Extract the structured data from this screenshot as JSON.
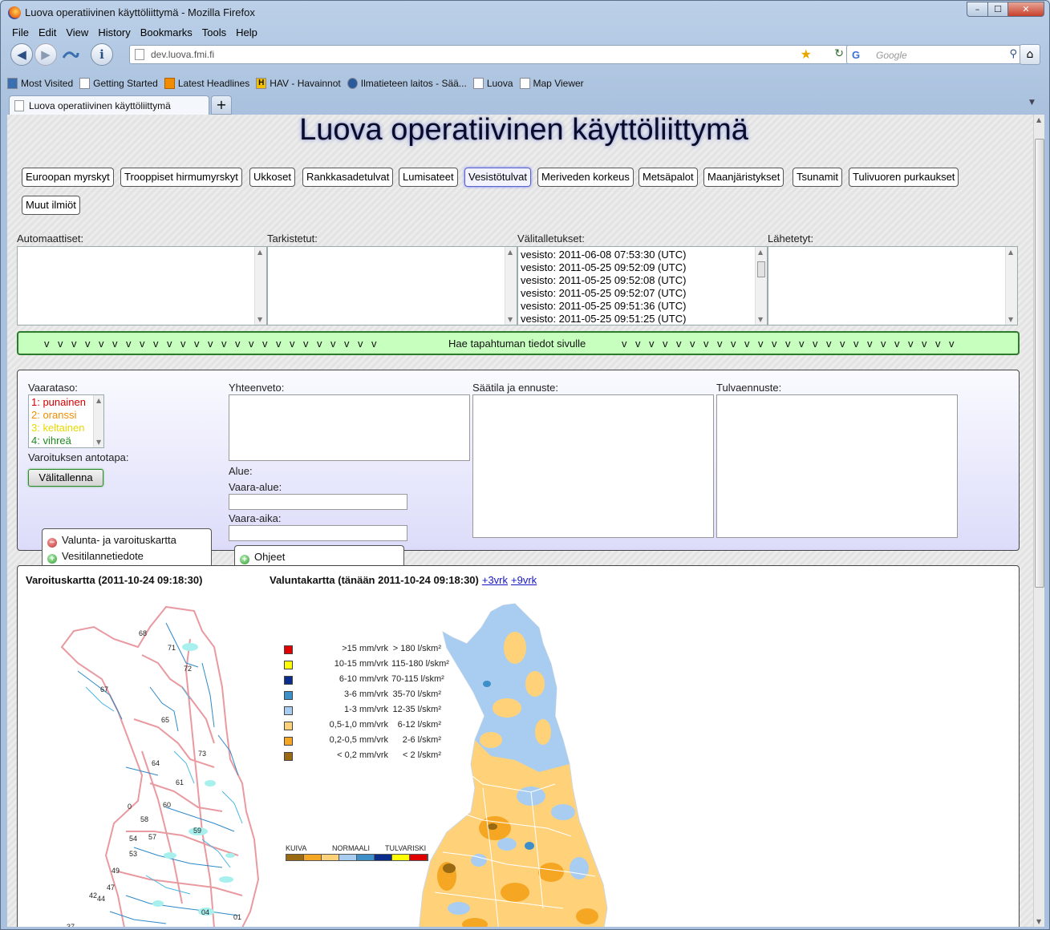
{
  "window": {
    "title": "Luova operatiivinen käyttöliittymä - Mozilla Firefox",
    "controls": {
      "min": "–",
      "max": "☐",
      "close": "✕"
    }
  },
  "menus": [
    "File",
    "Edit",
    "View",
    "History",
    "Bookmarks",
    "Tools",
    "Help"
  ],
  "nav": {
    "back": "◀",
    "forward": "▶",
    "url": "dev.luova.fmi.fi",
    "search_placeholder": "Google",
    "home": "⌂"
  },
  "bookmarks": [
    "Most Visited",
    "Getting Started",
    "Latest Headlines",
    "HAV - Havainnot",
    "Ilmatieteen laitos - Sää...",
    "Luova",
    "Map Viewer"
  ],
  "tabs": {
    "active": "Luova operatiivinen käyttöliittymä",
    "new_tab": "+"
  },
  "page": {
    "title": "Luova operatiivinen käyttöliittymä",
    "categories": [
      "Euroopan myrskyt",
      "Trooppiset hirmumyrskyt",
      "Ukkoset",
      "Rankkasadetulvat",
      "Lumisateet",
      "Vesistötulvat",
      "Meriveden korkeus",
      "Metsäpalot",
      "Maanjäristykset",
      "Tsunamit",
      "Tulivuoren purkaukset",
      "Muut ilmiöt"
    ],
    "selected_category": "Vesistötulvat",
    "lists": {
      "automatic": {
        "label": "Automaattiset:",
        "items": []
      },
      "checked": {
        "label": "Tarkistetut:",
        "items": []
      },
      "saved": {
        "label": "Välitalletukset:",
        "items": [
          "vesisto: 2011-06-08 07:53:30 (UTC)",
          "vesisto: 2011-05-25 09:52:09 (UTC)",
          "vesisto: 2011-05-25 09:52:08 (UTC)",
          "vesisto: 2011-05-25 09:52:07 (UTC)",
          "vesisto: 2011-05-25 09:51:36 (UTC)",
          "vesisto: 2011-05-25 09:51:25 (UTC)"
        ]
      },
      "sent": {
        "label": "Lähetetyt:",
        "items": []
      }
    },
    "fetch_bar": {
      "label": "Hae tapahtuman tiedot sivulle",
      "arrows": "v"
    },
    "form": {
      "danger_level_label": "Vaarataso:",
      "danger_levels": [
        {
          "text": "1: punainen",
          "color": "#d40000"
        },
        {
          "text": "2: oranssi",
          "color": "#f08c00"
        },
        {
          "text": "3: keltainen",
          "color": "#e8d800"
        },
        {
          "text": "4: vihreä",
          "color": "#1f8a1f"
        }
      ],
      "warning_method_label": "Varoituksen antotapa:",
      "save_button": "Välitallenna",
      "summary_label": "Yhteenveto:",
      "area_label": "Alue:",
      "danger_area_label": "Vaara-alue:",
      "danger_time_label": "Vaara-aika:",
      "weather_label": "Säätila ja ennuste:",
      "flood_label": "Tulvaennuste:"
    },
    "map_tabs": {
      "runoff_warning_map": "Valunta- ja varoituskartta",
      "water_bulletin": "Vesitilannetiedote",
      "instructions": "Ohjeet"
    },
    "maps": {
      "warning_title": "Varoituskartta (2011-10-24 09:18:30)",
      "runoff_title": "Valuntakartta (tänään 2011-10-24 09:18:30)",
      "link_3": "+3vrk",
      "link_9": "+9vrk",
      "warning_numbers": [
        "68",
        "71",
        "72",
        "67",
        "65",
        "73",
        "64",
        "61",
        "0",
        "60",
        "58",
        "59",
        "54",
        "57",
        "53",
        "49",
        "47",
        "42",
        "44",
        "04",
        "01",
        "37"
      ],
      "legend": [
        {
          "color": "#e00000",
          "mm": ">15 mm/vrk",
          "l": "> 180 l/skm²"
        },
        {
          "color": "#ffff00",
          "mm": "10-15 mm/vrk",
          "l": "115-180 l/skm²"
        },
        {
          "color": "#0a2c8a",
          "mm": "6-10 mm/vrk",
          "l": "70-115 l/skm²"
        },
        {
          "color": "#3c8fc8",
          "mm": "3-6 mm/vrk",
          "l": "35-70 l/skm²"
        },
        {
          "color": "#a8cdf0",
          "mm": "1-3 mm/vrk",
          "l": "12-35 l/skm²"
        },
        {
          "color": "#ffd27a",
          "mm": "0,5-1,0 mm/vrk",
          "l": "6-12 l/skm²"
        },
        {
          "color": "#f5a623",
          "mm": "0,2-0,5 mm/vrk",
          "l": "2-6 l/skm²"
        },
        {
          "color": "#9a6a12",
          "mm": "< 0,2 mm/vrk",
          "l": "< 2 l/skm²"
        }
      ],
      "scale_labels": [
        "KUIVA",
        "NORMAALI",
        "TULVARISKI"
      ],
      "scale_colors": [
        "#9a6a12",
        "#f5a623",
        "#ffd27a",
        "#a8cdf0",
        "#3c8fc8",
        "#0a2c8a",
        "#ffff00",
        "#e00000"
      ]
    }
  }
}
